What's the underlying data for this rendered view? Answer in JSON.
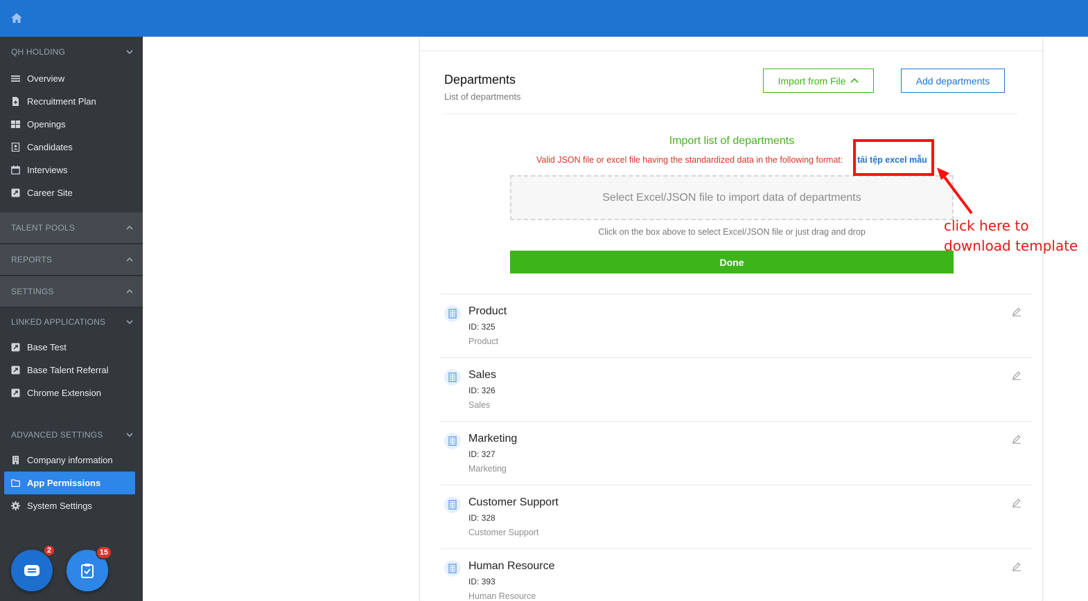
{
  "sidebar": {
    "company": "QH HOLDING",
    "main_items": [
      {
        "label": "Overview",
        "icon": "list-icon"
      },
      {
        "label": "Recruitment Plan",
        "icon": "file-plus-icon"
      },
      {
        "label": "Openings",
        "icon": "grid-icon"
      },
      {
        "label": "Candidates",
        "icon": "contact-book-icon"
      },
      {
        "label": "Interviews",
        "icon": "calendar-icon"
      },
      {
        "label": "Career Site",
        "icon": "external-link-icon"
      }
    ],
    "talent_pools": "TALENT POOLS",
    "reports": "REPORTS",
    "settings": "SETTINGS",
    "linked_header": "LINKED APPLICATIONS",
    "linked_items": [
      {
        "label": "Base Test",
        "icon": "external-link-icon"
      },
      {
        "label": "Base Talent Referral",
        "icon": "external-link-icon"
      },
      {
        "label": "Chrome Extension",
        "icon": "external-link-icon"
      }
    ],
    "advanced_header": "ADVANCED SETTINGS",
    "advanced_items": [
      {
        "label": "Company information",
        "icon": "building-icon"
      },
      {
        "label": "App Permissions",
        "icon": "folder-icon",
        "active": true
      },
      {
        "label": "System Settings",
        "icon": "gear-icon"
      }
    ],
    "chat_badge": "2",
    "task_badge": "15"
  },
  "departments": {
    "title": "Departments",
    "subtitle": "List of departments",
    "import_button": "Import from File",
    "add_button": "Add departments",
    "import_panel": {
      "title": "Import list of departments",
      "description": "Valid JSON file or excel file having the standardized data in the following format:",
      "template_link": "tải tệp excel mẫu",
      "dropzone": "Select Excel/JSON file to import data of departments",
      "hint": "Click on the box above to select Excel/JSON file or just drag and drop",
      "done": "Done"
    },
    "items": [
      {
        "name": "Product",
        "id": "ID: 325",
        "desc": "Product"
      },
      {
        "name": "Sales",
        "id": "ID: 326",
        "desc": "Sales"
      },
      {
        "name": "Marketing",
        "id": "ID: 327",
        "desc": "Marketing"
      },
      {
        "name": "Customer Support",
        "id": "ID: 328",
        "desc": "Customer Support"
      },
      {
        "name": "Human Resource",
        "id": "ID: 393",
        "desc": "Human Resource"
      }
    ]
  },
  "annotation": {
    "line1": "click here to",
    "line2": "download template",
    "color": "#e81818"
  },
  "colors": {
    "topbar": "#1f74d2",
    "sidebar": "#33383d",
    "accent_green": "#3db51a",
    "accent_blue": "#1f74d2",
    "error_red": "#d9342b"
  }
}
